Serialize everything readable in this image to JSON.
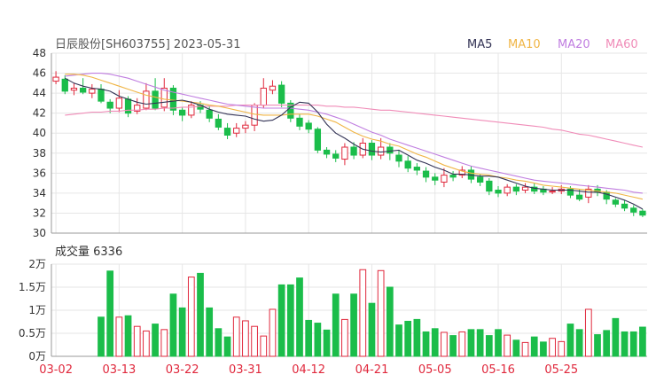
{
  "chart_data": [
    {
      "type": "candlestick",
      "title": "日辰股份[SH603755] 2023-05-31",
      "legend": [
        "MA5",
        "MA10",
        "MA20",
        "MA60"
      ],
      "legend_placement": "top-right",
      "colors": {
        "up": "#e0283c",
        "down": "#1bbd4a",
        "MA5": "#333355",
        "MA10": "#f0b545",
        "MA20": "#c07ee0",
        "MA60": "#f08cb8",
        "grid": "#e6e6e6",
        "axis": "#999999"
      },
      "ylim": [
        30,
        48
      ],
      "yticks": [
        "48",
        "46",
        "44",
        "42",
        "40",
        "38",
        "36",
        "34",
        "32",
        "30"
      ],
      "x_labels": [
        "03-02",
        "03-13",
        "03-22",
        "03-31",
        "04-12",
        "04-21",
        "05-05",
        "05-16",
        "05-25"
      ],
      "x_label_index": [
        0,
        7,
        14,
        21,
        28,
        35,
        42,
        49,
        56
      ],
      "grid": true,
      "candles": [
        [
          45.2,
          45.6,
          46.2,
          44.9
        ],
        [
          45.4,
          44.2,
          45.8,
          43.9
        ],
        [
          44.3,
          44.5,
          45.0,
          43.8
        ],
        [
          44.5,
          44.1,
          45.5,
          43.9
        ],
        [
          44.0,
          44.4,
          44.9,
          43.5
        ],
        [
          44.4,
          43.2,
          44.9,
          43.0
        ],
        [
          43.1,
          42.5,
          43.4,
          42.0
        ],
        [
          42.5,
          43.5,
          44.3,
          42.1
        ],
        [
          43.4,
          42.0,
          43.7,
          41.6
        ],
        [
          42.2,
          42.8,
          43.5,
          41.9
        ],
        [
          42.5,
          44.2,
          45.0,
          42.3
        ],
        [
          44.2,
          42.5,
          45.5,
          42.3
        ],
        [
          42.6,
          44.5,
          45.5,
          42.2
        ],
        [
          44.5,
          42.3,
          44.8,
          41.8
        ],
        [
          42.3,
          41.8,
          42.6,
          41.2
        ],
        [
          41.8,
          42.8,
          43.2,
          41.5
        ],
        [
          42.8,
          42.4,
          43.2,
          42.0
        ],
        [
          42.3,
          41.5,
          42.7,
          41.1
        ],
        [
          41.4,
          40.6,
          41.9,
          40.3
        ],
        [
          40.5,
          39.8,
          41.0,
          39.4
        ],
        [
          40.0,
          40.5,
          41.0,
          39.6
        ],
        [
          40.5,
          40.8,
          41.2,
          40.0
        ],
        [
          40.8,
          42.8,
          43.0,
          40.2
        ],
        [
          42.8,
          44.5,
          45.5,
          42.5
        ],
        [
          44.3,
          44.7,
          45.3,
          43.9
        ],
        [
          44.8,
          43.0,
          45.2,
          42.6
        ],
        [
          43.0,
          41.5,
          43.3,
          41.1
        ],
        [
          41.5,
          40.7,
          41.9,
          40.3
        ],
        [
          41.0,
          40.4,
          41.3,
          40.0
        ],
        [
          40.4,
          38.3,
          40.6,
          38.0
        ],
        [
          38.3,
          37.9,
          38.6,
          37.5
        ],
        [
          37.9,
          37.5,
          38.3,
          37.1
        ],
        [
          37.4,
          38.6,
          39.0,
          36.8
        ],
        [
          38.6,
          37.8,
          39.1,
          37.4
        ],
        [
          37.8,
          39.0,
          39.5,
          37.5
        ],
        [
          39.0,
          37.8,
          39.3,
          37.3
        ],
        [
          37.8,
          38.6,
          39.5,
          37.4
        ],
        [
          38.6,
          38.0,
          39.0,
          37.3
        ],
        [
          37.8,
          37.2,
          38.3,
          36.6
        ],
        [
          37.2,
          36.5,
          37.7,
          36.1
        ],
        [
          36.6,
          36.3,
          37.0,
          35.8
        ],
        [
          36.2,
          35.6,
          36.6,
          35.1
        ],
        [
          35.6,
          35.3,
          36.0,
          34.8
        ],
        [
          35.1,
          35.8,
          36.5,
          34.6
        ],
        [
          35.8,
          35.6,
          36.2,
          35.2
        ],
        [
          35.8,
          36.3,
          36.7,
          35.5
        ],
        [
          36.3,
          35.4,
          36.7,
          35.0
        ],
        [
          35.6,
          35.1,
          35.9,
          34.7
        ],
        [
          35.2,
          34.2,
          35.5,
          33.8
        ],
        [
          34.3,
          34.0,
          34.7,
          33.6
        ],
        [
          34.0,
          34.6,
          34.9,
          33.7
        ],
        [
          34.6,
          34.2,
          34.9,
          33.8
        ],
        [
          34.3,
          34.6,
          35.0,
          34.0
        ],
        [
          34.6,
          34.2,
          35.0,
          33.9
        ],
        [
          34.4,
          34.1,
          34.7,
          33.8
        ],
        [
          34.2,
          34.2,
          34.6,
          33.9
        ],
        [
          34.2,
          34.4,
          34.8,
          33.9
        ],
        [
          34.4,
          33.8,
          34.7,
          33.5
        ],
        [
          33.8,
          33.4,
          34.4,
          33.2
        ],
        [
          33.6,
          34.4,
          34.8,
          33.0
        ],
        [
          34.4,
          34.1,
          34.8,
          33.7
        ],
        [
          34.1,
          33.4,
          34.3,
          32.9
        ],
        [
          33.3,
          32.9,
          33.5,
          32.6
        ],
        [
          32.9,
          32.5,
          33.3,
          32.2
        ],
        [
          32.5,
          32.1,
          32.8,
          31.7
        ],
        [
          32.2,
          31.8,
          32.4,
          31.6
        ]
      ],
      "ma": {
        "MA5": [
          45.5,
          45.0,
          44.7,
          44.5,
          44.4,
          44.2,
          43.7,
          43.4,
          43.1,
          42.9,
          43.0,
          43.1,
          43.2,
          43.3,
          43.1,
          42.8,
          42.4,
          42.1,
          41.9,
          41.8,
          41.7,
          41.4,
          41.2,
          41.3,
          41.8,
          42.6,
          43.1,
          43.0,
          42.1,
          40.9,
          40.0,
          39.5,
          38.9,
          38.4,
          38.2,
          38.1,
          38.2,
          38.3,
          37.8,
          37.3,
          37.0,
          36.6,
          36.3,
          35.9,
          35.9,
          35.8,
          35.7,
          35.7,
          35.6,
          35.3,
          35.0,
          34.7,
          34.5,
          34.4,
          34.3,
          34.3,
          34.3,
          34.2,
          34.1,
          34.1,
          33.9,
          33.6,
          33.3,
          32.9,
          32.4
        ],
        "MA10": [
          45.9,
          45.9,
          45.8,
          45.6,
          45.3,
          45.0,
          44.7,
          44.4,
          44.1,
          43.8,
          43.6,
          43.4,
          43.3,
          43.2,
          43.1,
          43.0,
          42.8,
          42.7,
          42.5,
          42.3,
          42.1,
          41.9,
          41.8,
          41.8,
          41.8,
          41.9,
          41.9,
          41.9,
          41.7,
          41.4,
          41.1,
          40.6,
          40.1,
          39.7,
          39.4,
          39.2,
          38.9,
          38.7,
          38.3,
          37.9,
          37.6,
          37.2,
          36.8,
          36.5,
          36.2,
          36.0,
          35.9,
          35.8,
          35.6,
          35.5,
          35.3,
          35.2,
          35.0,
          34.8,
          34.7,
          34.6,
          34.5,
          34.4,
          34.3,
          34.2,
          34.1,
          34.0,
          33.8,
          33.6,
          33.4
        ],
        "MA20": [
          45.7,
          45.8,
          45.9,
          46.0,
          46.0,
          45.9,
          45.7,
          45.5,
          45.2,
          44.9,
          44.6,
          44.3,
          44.1,
          43.9,
          43.7,
          43.5,
          43.3,
          43.1,
          42.9,
          42.8,
          42.7,
          42.6,
          42.5,
          42.5,
          42.5,
          42.5,
          42.4,
          42.3,
          42.1,
          41.9,
          41.6,
          41.3,
          40.9,
          40.5,
          40.1,
          39.8,
          39.4,
          39.1,
          38.8,
          38.5,
          38.2,
          37.9,
          37.6,
          37.3,
          37.0,
          36.7,
          36.5,
          36.3,
          36.1,
          35.9,
          35.7,
          35.5,
          35.3,
          35.2,
          35.1,
          35.0,
          34.9,
          34.8,
          34.7,
          34.6,
          34.5,
          34.4,
          34.3,
          34.1,
          34.0
        ],
        "MA60": [
          41.8,
          41.9,
          42.0,
          42.1,
          42.1,
          42.2,
          42.2,
          42.3,
          42.3,
          42.4,
          42.4,
          42.5,
          42.5,
          42.6,
          42.6,
          42.7,
          42.7,
          42.7,
          42.7,
          42.8,
          42.8,
          42.8,
          42.8,
          42.8,
          42.8,
          42.8,
          42.8,
          42.8,
          42.8,
          42.7,
          42.7,
          42.6,
          42.6,
          42.5,
          42.4,
          42.3,
          42.3,
          42.2,
          42.1,
          42.0,
          41.9,
          41.8,
          41.7,
          41.6,
          41.5,
          41.4,
          41.3,
          41.2,
          41.1,
          41.0,
          40.9,
          40.8,
          40.7,
          40.6,
          40.4,
          40.3,
          40.1,
          39.9,
          39.8,
          39.6,
          39.4,
          39.2,
          39.0,
          38.8,
          38.6
        ]
      }
    },
    {
      "type": "bar",
      "title": "成交量 6336",
      "ylim": [
        0,
        20000
      ],
      "yticks": [
        "2万",
        "1.5万",
        "1万",
        "0.5万",
        "0万"
      ],
      "x_labels": [
        "03-02",
        "03-13",
        "03-22",
        "03-31",
        "04-12",
        "04-21",
        "05-05",
        "05-16",
        "05-25"
      ],
      "grid": true,
      "values": [
        8500,
        18500,
        8500,
        8800,
        6500,
        5500,
        7000,
        5800,
        13500,
        10500,
        17200,
        18000,
        10500,
        6000,
        4200,
        8500,
        7700,
        6500,
        4400,
        10200,
        15500,
        15500,
        17000,
        7800,
        7200,
        5700,
        13500,
        8000,
        13500,
        18800,
        11500,
        18600,
        15000,
        6800,
        7600,
        8000,
        5300,
        6000,
        5200,
        4500,
        5300,
        5800,
        5800,
        4500,
        5800,
        4600,
        3500,
        3000,
        4200,
        3100,
        3900,
        3200,
        7000,
        5800,
        10200,
        4700,
        5600,
        8200,
        5300,
        5300,
        6336
      ]
    }
  ]
}
